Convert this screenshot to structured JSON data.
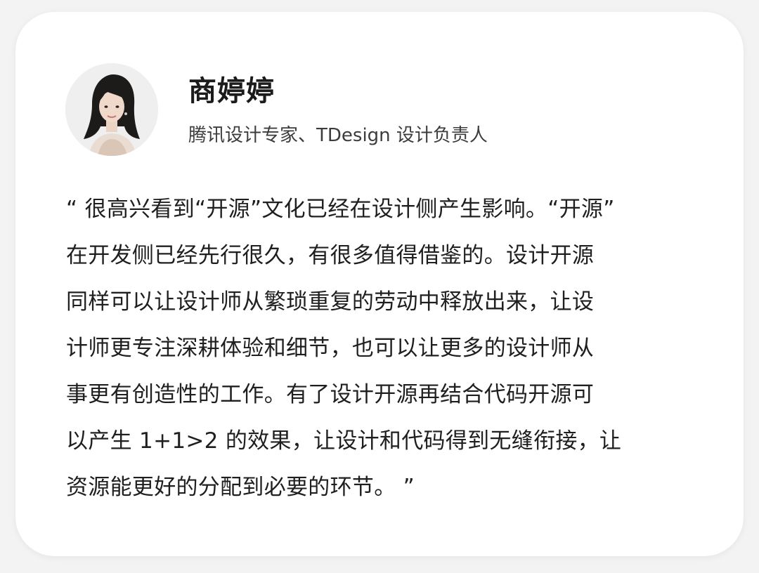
{
  "profile": {
    "name": "商婷婷",
    "title": "腾讯设计专家、TDesign 设计负责人"
  },
  "quote": {
    "text": "“ 很高兴看到“开源”文化已经在设计侧产生影响。“开源”\n在开发侧已经先行很久，有很多值得借鉴的。设计开源\n同样可以让设计师从繁琐重复的劳动中释放出来，让设\n计师更专注深耕体验和细节，也可以让更多的设计师从\n事更有创造性的工作。有了设计开源再结合代码开源可\n以产生 1+1>2 的效果，让设计和代码得到无缝衔接，让\n资源能更好的分配到必要的环节。 ”"
  },
  "colors": {
    "background": "#f3f3f3",
    "card": "#ffffff",
    "text_primary": "#1b1b1b",
    "text_secondary": "#3c3c3c"
  }
}
